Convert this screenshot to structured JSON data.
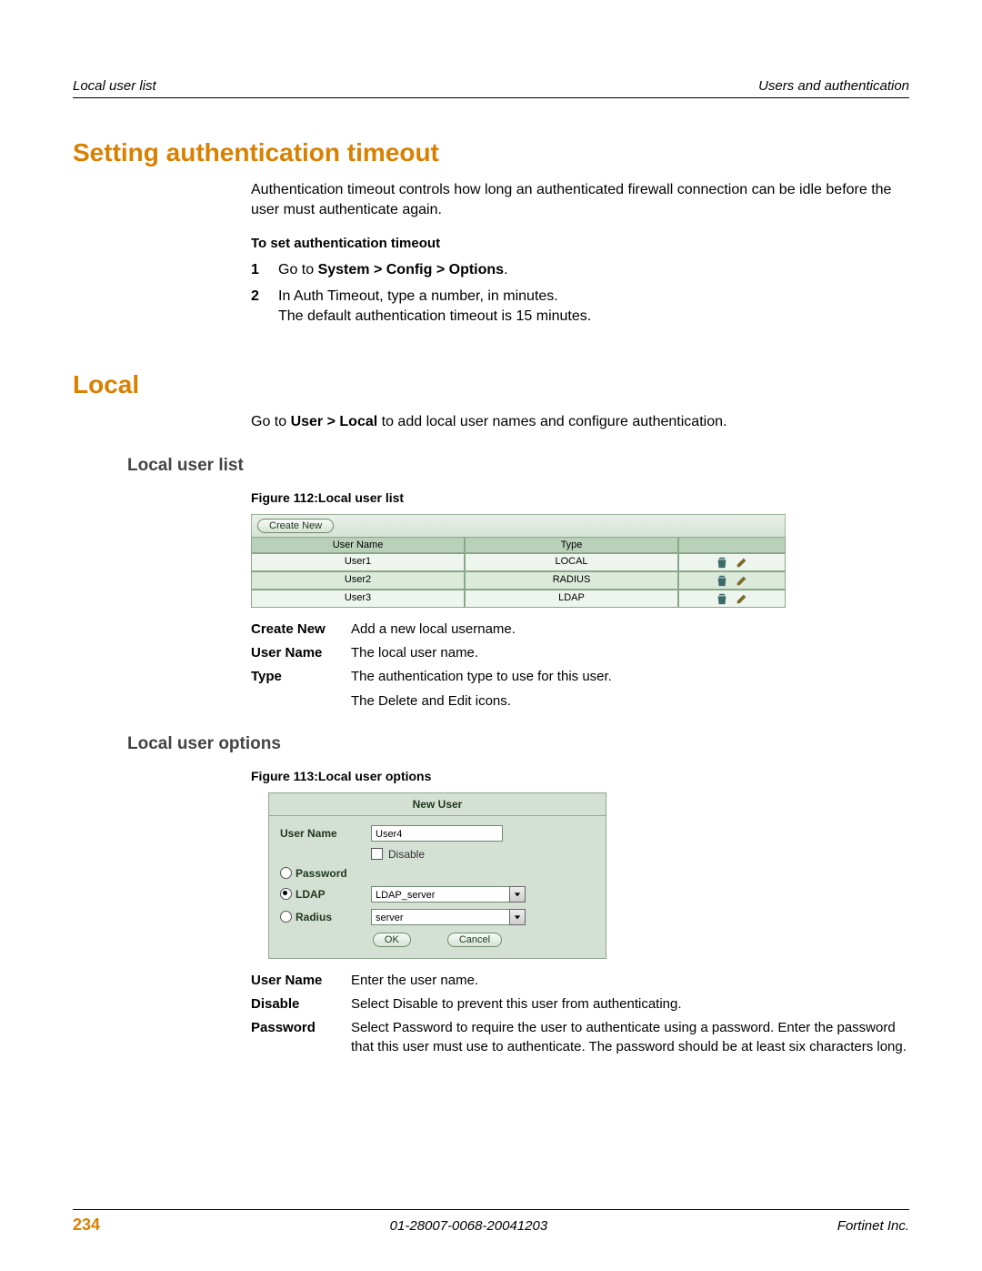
{
  "header": {
    "left": "Local user list",
    "right": "Users and authentication"
  },
  "section1": {
    "title": "Setting authentication timeout",
    "intro": "Authentication timeout controls how long an authenticated firewall connection can be idle before the user must authenticate again.",
    "subhead": "To set authentication timeout",
    "steps": [
      {
        "num": "1",
        "prefix": "Go to ",
        "bold": "System > Config > Options",
        "suffix": "."
      },
      {
        "num": "2",
        "text": "In Auth Timeout, type a number, in minutes.\nThe default authentication timeout is 15 minutes."
      }
    ]
  },
  "section2": {
    "title": "Local",
    "intro_prefix": "Go to ",
    "intro_bold": "User > Local",
    "intro_suffix": " to add local user names and configure authentication.",
    "sub1": {
      "heading": "Local user list",
      "figcap": "Figure 112:Local user list",
      "create_btn": "Create New",
      "cols": {
        "user": "User Name",
        "type": "Type"
      },
      "rows": [
        {
          "user": "User1",
          "type": "LOCAL"
        },
        {
          "user": "User2",
          "type": "RADIUS"
        },
        {
          "user": "User3",
          "type": "LDAP"
        }
      ],
      "desc": [
        {
          "label": "Create New",
          "text": "Add a new local username."
        },
        {
          "label": "User Name",
          "text": "The local user name."
        },
        {
          "label": "Type",
          "text": "The authentication type to use for this user."
        },
        {
          "label": "",
          "text": "The Delete and Edit icons."
        }
      ]
    },
    "sub2": {
      "heading": "Local user options",
      "figcap": "Figure 113:Local user options",
      "panel": {
        "title": "New User",
        "username_label": "User Name",
        "username_value": "User4",
        "disable_label": "Disable",
        "password_label": "Password",
        "ldap_label": "LDAP",
        "ldap_value": "LDAP_server",
        "radius_label": "Radius",
        "radius_value": "server",
        "ok": "OK",
        "cancel": "Cancel"
      },
      "desc": [
        {
          "label": "User Name",
          "text": "Enter the user name."
        },
        {
          "label": "Disable",
          "text": "Select Disable to prevent this user from authenticating."
        },
        {
          "label": "Password",
          "text": "Select Password to require the user to authenticate using a password. Enter the password that this user must use to authenticate. The password should be at least six characters long."
        }
      ]
    }
  },
  "footer": {
    "page": "234",
    "docid": "01-28007-0068-20041203",
    "company": "Fortinet Inc."
  }
}
